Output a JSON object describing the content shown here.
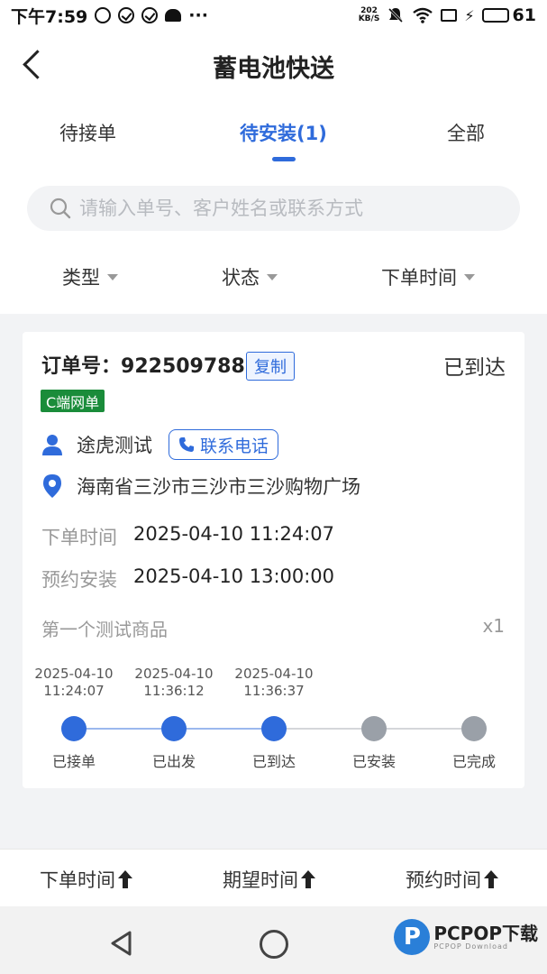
{
  "status_bar": {
    "time": "下午7:59",
    "net_speed_value": "202",
    "net_speed_unit": "KB/S",
    "battery": "61",
    "battery_level_percent": 61
  },
  "header": {
    "title": "蓄电池快送"
  },
  "tabs": [
    {
      "label": "待接单",
      "active": false
    },
    {
      "label": "待安装(1)",
      "active": true
    },
    {
      "label": "全部",
      "active": false
    }
  ],
  "search": {
    "placeholder": "请输入单号、客户姓名或联系方式"
  },
  "filters": [
    {
      "label": "类型"
    },
    {
      "label": "状态"
    },
    {
      "label": "下单时间"
    }
  ],
  "order": {
    "order_label": "订单号：",
    "order_no": "922509788",
    "copy_label": "复制",
    "status": "已到达",
    "tag": "C端网单",
    "customer_name": "途虎测试",
    "phone_label": "联系电话",
    "address": "海南省三沙市三沙市三沙购物广场",
    "order_time_label": "下单时间",
    "order_time": "2025-04-10 11:24:07",
    "install_time_label": "预约安装",
    "install_time": "2025-04-10 13:00:00",
    "goods_name": "第一个测试商品",
    "goods_qty": "x1",
    "timeline": [
      {
        "label": "已接单",
        "date": "2025-04-10",
        "time": "11:24:07",
        "done": true
      },
      {
        "label": "已出发",
        "date": "2025-04-10",
        "time": "11:36:12",
        "done": true
      },
      {
        "label": "已到达",
        "date": "2025-04-10",
        "time": "11:36:37",
        "done": true
      },
      {
        "label": "已安装",
        "date": "",
        "time": "",
        "done": false
      },
      {
        "label": "已完成",
        "date": "",
        "time": "",
        "done": false
      }
    ]
  },
  "sort_bar": [
    {
      "label": "下单时间"
    },
    {
      "label": "期望时间"
    },
    {
      "label": "预约时间"
    }
  ],
  "watermark": {
    "logo": "P",
    "text": "PCPOP下载",
    "sub": "PCPOP Download"
  },
  "colors": {
    "accent": "#2f6bdb",
    "tag_green": "#1a8c3a",
    "pending_gray": "#9aa0a8"
  }
}
